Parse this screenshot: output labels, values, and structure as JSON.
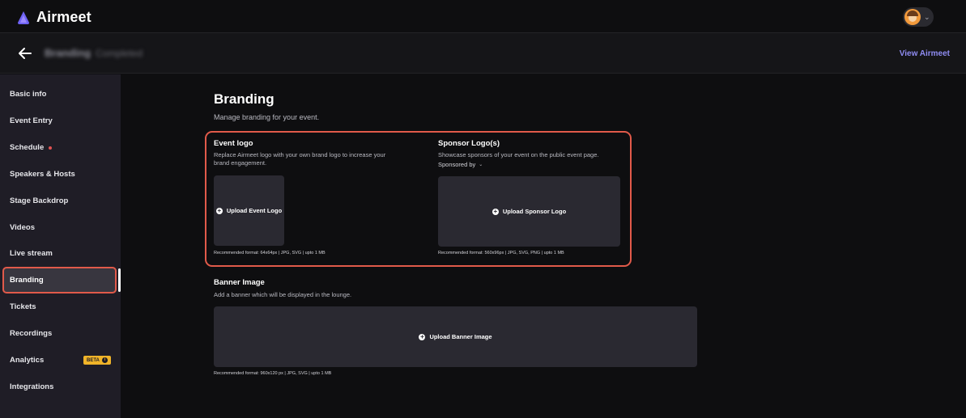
{
  "app": {
    "name": "Airmeet"
  },
  "header": {
    "event_name": "Branding",
    "event_status": "Completed",
    "view_link": "View Airmeet"
  },
  "sidebar": {
    "items": [
      {
        "label": "Basic info"
      },
      {
        "label": "Event Entry"
      },
      {
        "label": "Schedule"
      },
      {
        "label": "Speakers & Hosts"
      },
      {
        "label": "Stage Backdrop"
      },
      {
        "label": "Videos"
      },
      {
        "label": "Live stream"
      },
      {
        "label": "Branding"
      },
      {
        "label": "Tickets"
      },
      {
        "label": "Recordings"
      },
      {
        "label": "Analytics"
      },
      {
        "label": "Integrations"
      }
    ],
    "active_index": 7,
    "beta_badge": "BETA"
  },
  "main": {
    "title": "Branding",
    "subtitle": "Manage branding for your event.",
    "event_logo": {
      "title": "Event logo",
      "desc_line1": "Replace Airmeet logo with your own brand logo to increase your",
      "desc_line2": "brand engagement.",
      "upload_label": "Upload Event Logo",
      "recommended": "Recommended format: 64x64px | JPG, SVG | upto 1 MB"
    },
    "sponsor_logo": {
      "title": "Sponsor Logo(s)",
      "desc": "Showcase sponsors of your event on the public event page.",
      "sponsored_by": "Sponsored by",
      "upload_label": "Upload Sponsor Logo",
      "recommended": "Recommended format: 560x96px | JPG, SVG, PNG | upto 1 MB"
    },
    "banner": {
      "title": "Banner Image",
      "desc": "Add a banner which will be displayed in the lounge.",
      "upload_label": "Upload Banner Image",
      "recommended": "Recommended format: 960x120 px | JPG, SVG | upto 1 MB"
    }
  },
  "colors": {
    "background": "#0e0e10",
    "sidebar": "#1f1d26",
    "highlight": "#e15a4a",
    "accent_link": "#8f8cf2",
    "beta": "#f0b429"
  }
}
